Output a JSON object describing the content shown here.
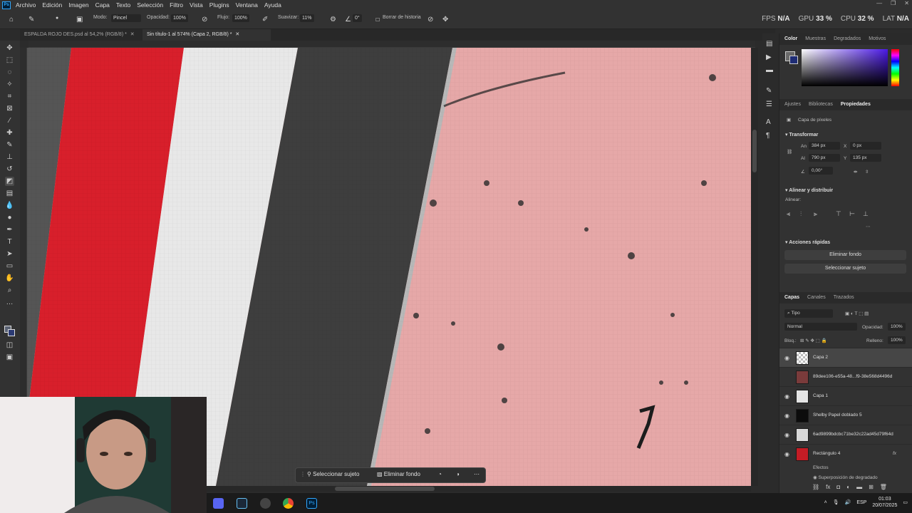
{
  "app": {
    "logo_text": "Ps"
  },
  "menu": [
    "Archivo",
    "Edición",
    "Imagen",
    "Capa",
    "Texto",
    "Selección",
    "Filtro",
    "Vista",
    "Plugins",
    "Ventana",
    "Ayuda"
  ],
  "options_bar": {
    "modo_label": "Modo:",
    "modo_value": "Pincel",
    "opacidad_label": "Opacidad:",
    "opacidad_value": "100%",
    "flujo_label": "Flujo:",
    "flujo_value": "100%",
    "suavizar_label": "Suavizar:",
    "suavizar_value": "11%",
    "angle_value": "0°",
    "borrar_historia": "Borrar de historia"
  },
  "perf": {
    "fps_label": "FPS",
    "fps_value": "N/A",
    "gpu_label": "GPU",
    "gpu_value": "33 %",
    "cpu_label": "CPU",
    "cpu_value": "32 %",
    "lat_label": "LAT",
    "lat_value": "N/A"
  },
  "tabs": [
    {
      "label": "ESPALDA ROJO DES.psd al 54,2% (RGB/8) *"
    },
    {
      "label": "Sin título-1 al 574% (Capa 2, RGB/8) *"
    }
  ],
  "context_bar": {
    "select_subject": "Seleccionar sujeto",
    "remove_bg": "Eliminar fondo"
  },
  "panel_color": {
    "tabs": [
      "Color",
      "Muestras",
      "Degradados",
      "Motivos"
    ]
  },
  "panel_props": {
    "tabs": [
      "Ajustes",
      "Bibliotecas",
      "Propiedades"
    ],
    "layer_type": "Capa de píxeles",
    "transform_title": "Transformar",
    "w_label": "An",
    "w_value": "384 px",
    "h_label": "Al",
    "h_value": "790 px",
    "x_label": "X",
    "x_value": "0 px",
    "y_label": "Y",
    "y_value": "135 px",
    "angle_value": "0,00°",
    "align_title": "Alinear y distribuir",
    "align_label": "Alinear:",
    "quick_title": "Acciones rápidas",
    "btn_remove_bg": "Eliminar fondo",
    "btn_select_subject": "Seleccionar sujeto"
  },
  "panel_layers": {
    "tabs": [
      "Capas",
      "Canales",
      "Trazados"
    ],
    "filter_label": "Tipo",
    "blend_mode": "Normal",
    "opacity_label": "Opacidad:",
    "opacity_value": "100%",
    "lock_label": "Bloq.:",
    "fill_label": "Relleno:",
    "fill_value": "100%",
    "layers": [
      {
        "name": "Capa 2"
      },
      {
        "name": "89dee106-e55a-48...f9-38e568d4496d"
      },
      {
        "name": "Capa 1"
      },
      {
        "name": "Shelby Papel doblado 5"
      },
      {
        "name": "6ad9899bdcbc71be32c22ad45d79f64d"
      },
      {
        "name": "Rectángulo 4"
      }
    ],
    "effects_label": "Efectos",
    "effect_name": "Superposición de degradado",
    "fx_label": "fx"
  },
  "taskbar": {
    "lang": "ESP",
    "time": "01:03",
    "date": "20/07/2025"
  }
}
